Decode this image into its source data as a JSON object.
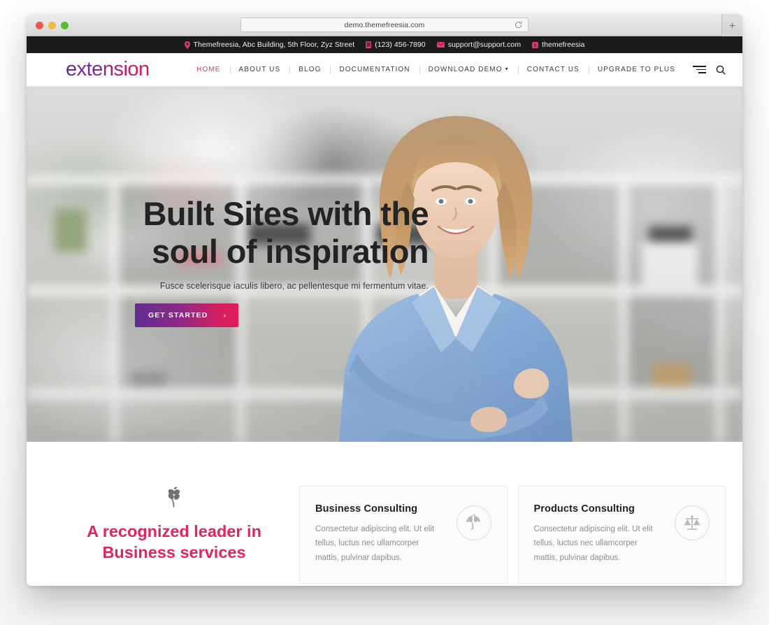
{
  "browser": {
    "url": "demo.themefreesia.com",
    "reload_icon": "reload-icon",
    "new_tab_label": "+",
    "traffic_lights": [
      "close",
      "minimize",
      "maximize"
    ]
  },
  "topbar": {
    "items": [
      {
        "icon": "map-marker-icon",
        "text": "Themefreesia, Abc Building, 5th Floor, Zyz Street"
      },
      {
        "icon": "phone-icon",
        "text": "(123) 456-7890"
      },
      {
        "icon": "envelope-icon",
        "text": "support@support.com"
      },
      {
        "icon": "skype-icon",
        "text": "themefreesia"
      }
    ],
    "background": "#1b1b1b",
    "icon_color": "#e3376d"
  },
  "header": {
    "logo": "extension",
    "logo_gradient_start": "#5f2d91",
    "logo_gradient_end": "#e01a5a",
    "nav": [
      {
        "label": "HOME",
        "active": true,
        "has_caret": false
      },
      {
        "label": "ABOUT US",
        "active": false,
        "has_caret": false
      },
      {
        "label": "BLOG",
        "active": false,
        "has_caret": false
      },
      {
        "label": "DOCUMENTATION",
        "active": false,
        "has_caret": false
      },
      {
        "label": "DOWNLOAD DEMO",
        "active": false,
        "has_caret": true
      },
      {
        "label": "CONTACT US",
        "active": false,
        "has_caret": false
      },
      {
        "label": "UPGRADE TO PLUS",
        "active": false,
        "has_caret": false
      }
    ],
    "tools": [
      "hamburger-icon",
      "search-icon"
    ],
    "active_color": "#e3376d"
  },
  "hero": {
    "title": "Built Sites with the\nsoul of inspiration",
    "subtitle": "Fusce scelerisque iaculis libero, ac pellentesque mi fermentum vitae.",
    "cta_label": "GET STARTED",
    "cta_arrow": "›",
    "cta_gradient_start": "#5f2d8f",
    "cta_gradient_end": "#e21c58"
  },
  "services": {
    "leaf_icon": "leaf-branch-icon",
    "heading": "A recognized leader in\nBusiness services",
    "heading_color": "#e3255f",
    "cards": [
      {
        "title": "Business Consulting",
        "description": "Consectetur adipiscing elit. Ut elit tellus, luctus nec ullamcorper mattis, pulvinar dapibus.",
        "icon": "umbrella-icon"
      },
      {
        "title": "Products Consulting",
        "description": "Consectetur adipiscing elit. Ut elit tellus, luctus nec ullamcorper mattis, pulvinar dapibus.",
        "icon": "balance-scales-icon"
      }
    ]
  }
}
